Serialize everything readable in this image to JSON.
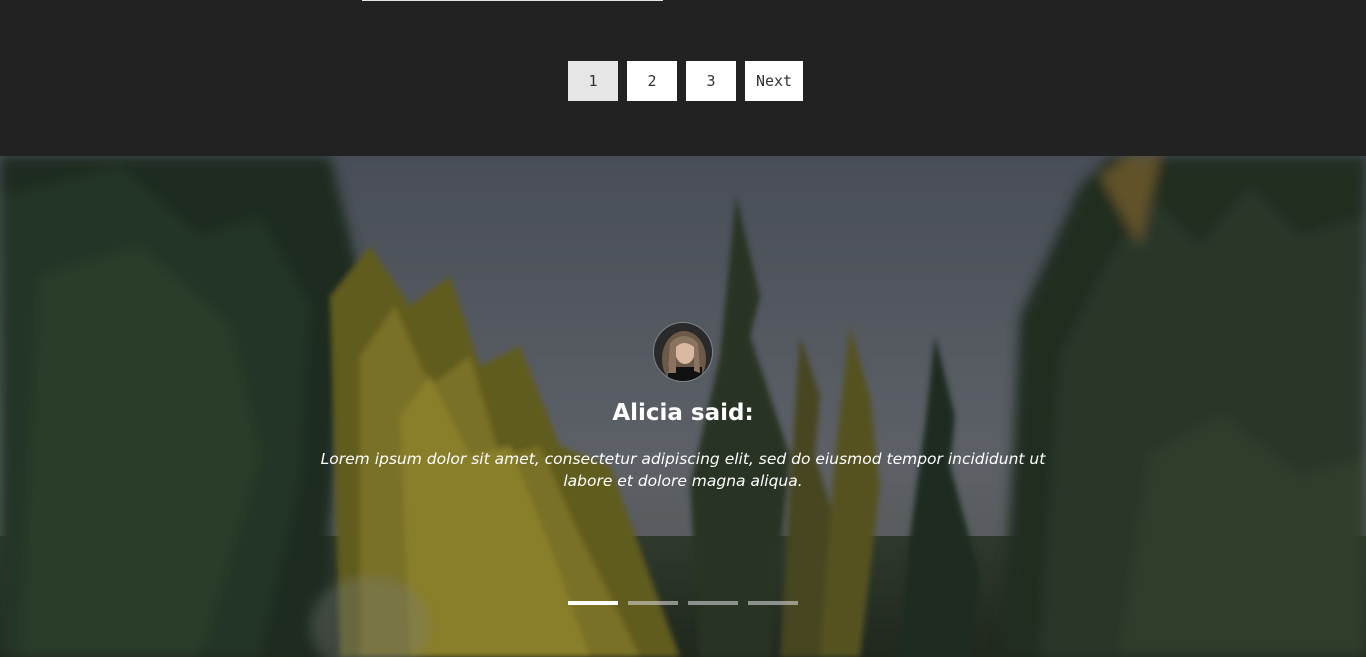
{
  "pagination": {
    "pages": [
      "1",
      "2",
      "3"
    ],
    "active_page": "1",
    "next_label": "Next"
  },
  "testimonial": {
    "title": "Alicia said:",
    "quote": "Lorem ipsum dolor sit amet, consectetur adipiscing elit, sed do eiusmod tempor incididunt ut labore et dolore magna aliqua.",
    "slide_count": 4,
    "active_slide": 1
  },
  "colors": {
    "page_background": "#222222",
    "button_background": "#ffffff",
    "button_active_background": "#e6e6e6",
    "text_light": "#ffffff"
  }
}
